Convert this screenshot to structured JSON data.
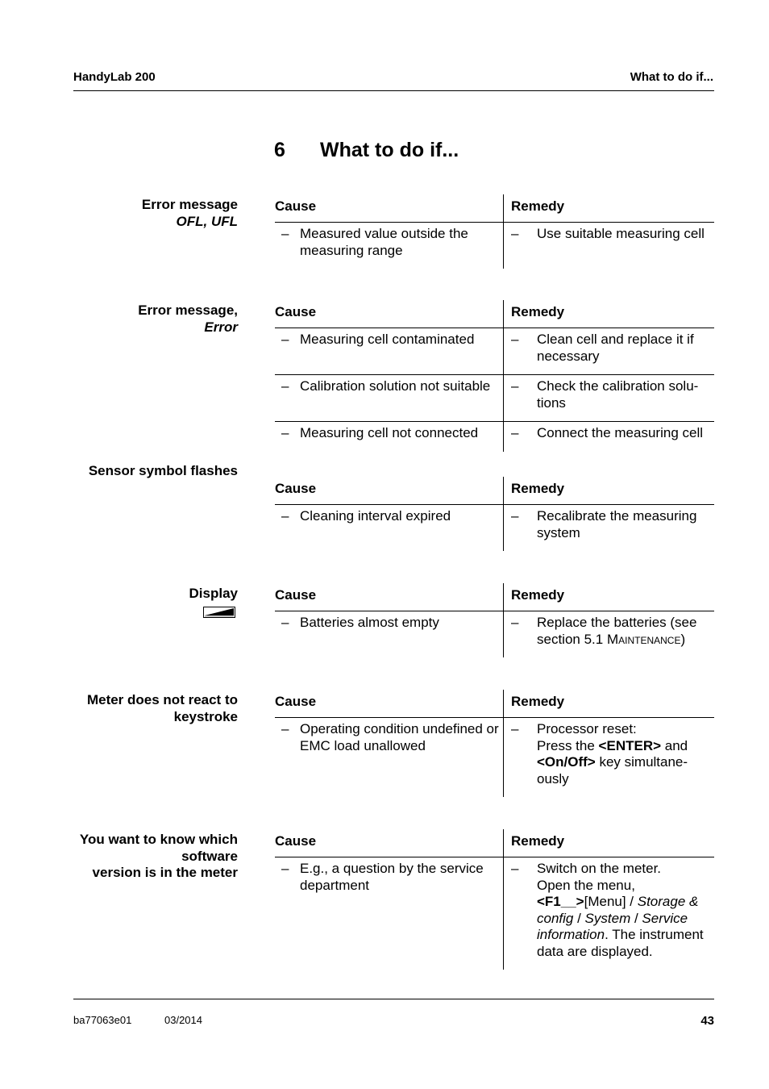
{
  "header": {
    "left": "HandyLab 200",
    "right": "What to do if..."
  },
  "chapter": {
    "number": "6",
    "title": "What to do if..."
  },
  "table_headers": {
    "cause": "Cause",
    "remedy": "Remedy"
  },
  "dash": "–",
  "sections": [
    {
      "label_line1": "Error message",
      "label_line2_italic": "OFL, UFL",
      "rows": [
        {
          "cause": "Measured value outside the measuring range",
          "remedy": "Use suitable measuring cell"
        }
      ]
    },
    {
      "label_line1": "Error message,",
      "label_line2_italic": "Error",
      "rows": [
        {
          "cause": "Measuring cell contaminated",
          "remedy": "Clean cell and replace it if necessary"
        },
        {
          "cause": "Calibration solution not suitable",
          "remedy": "Check the calibration solu-tions"
        },
        {
          "cause": "Measuring cell not connected",
          "remedy": "Connect the measuring cell"
        }
      ]
    },
    {
      "label_line1": "Sensor symbol flashes",
      "rows": [
        {
          "cause": "Cleaning interval expired",
          "remedy": "Recalibrate the measuring system"
        }
      ]
    },
    {
      "label_line1": "Display",
      "icon": "battery-low-icon",
      "rows": [
        {
          "cause": "Batteries almost empty",
          "remedy_prefix": "Replace the batteries (see section 5.1 ",
          "remedy_sc": "Maintenance",
          "remedy_suffix": ")"
        }
      ]
    },
    {
      "label_line1": "Meter does not react to",
      "label_line2": "keystroke",
      "rows": [
        {
          "cause": "Operating condition undefined or EMC load unallowed",
          "remedy_parts": [
            "Processor reset:",
            "Press the ",
            "<ENTER>",
            " and ",
            "<On/Off>",
            " key simultane-ously"
          ]
        }
      ]
    },
    {
      "label_line1": "You want to know which",
      "label_line2": "software",
      "label_line3": "version is in the meter",
      "rows": [
        {
          "cause": "E.g., a question by the service department",
          "remedy_parts": [
            "Switch on the meter.",
            "Open the menu,",
            "<F1__>",
            "[Menu] / ",
            "Storage & config",
            " / ",
            "System",
            " / ",
            "Service information",
            ". The instrument data are displayed."
          ]
        }
      ]
    }
  ],
  "footer": {
    "doc_id": "ba77063e01",
    "date": "03/2014",
    "page": "43"
  }
}
